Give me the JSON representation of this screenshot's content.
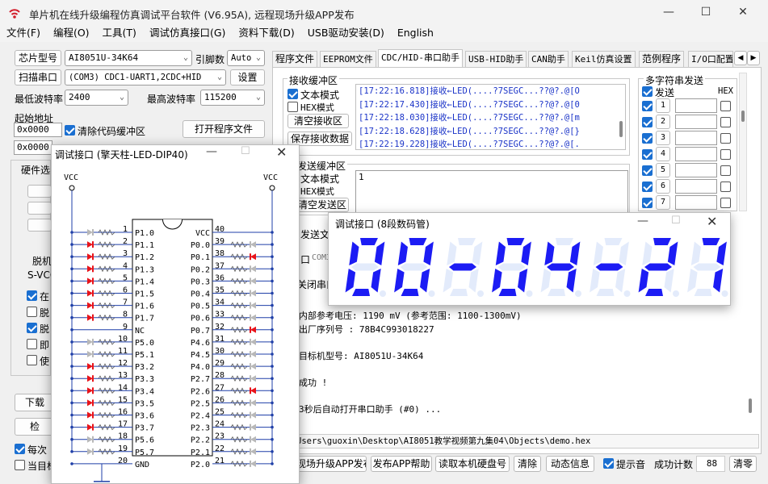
{
  "app": {
    "title": "单片机在线升级编程仿真调试平台软件 (V6.95A), 远程现场升级APP发布"
  },
  "menu": [
    "文件(F)",
    "编程(O)",
    "工具(T)",
    "调试仿真接口(G)",
    "资料下载(D)",
    "USB驱动安装(D)",
    "English"
  ],
  "left": {
    "chip_btn": "芯片型号",
    "chip": "AI8051U-34K64",
    "pins_label": "引脚数",
    "pins": "Auto",
    "scan_btn": "扫描串口",
    "port": "(COM3) CDC1-UART1,2CDC+HID",
    "settings_btn": "设置",
    "min_baud_label": "最低波特率",
    "min_baud": "2400",
    "max_baud_label": "最高波特率",
    "max_baud": "115200",
    "start_addr_label": "起始地址",
    "start_addr_1": "0x0000",
    "start_addr_2": "0x0000",
    "clear_cache_label": "清除代码缓冲区",
    "open_prog_btn": "打开程序文件",
    "hw_label": "硬件选",
    "partial": [
      "脱机",
      "S-VCC",
      "在",
      "脱",
      "脱",
      "即",
      "使"
    ],
    "download_btn": "下载",
    "check_btn": "检",
    "every_label": "每次",
    "current_label": "当目标"
  },
  "tabs": [
    "程序文件",
    "EEPROM文件",
    "CDC/HID-串口助手",
    "USB-HID助手",
    "CAN助手",
    "Keil仿真设置",
    "范例程序",
    "I/O口配置"
  ],
  "recv": {
    "title": "接收缓冲区",
    "text_mode": "文本模式",
    "hex_mode": "HEX模式",
    "clear_btn": "清空接收区",
    "save_btn": "保存接收数据",
    "lines": [
      "[17:22:16.818]接收←LED(....?7SEGC...??@?.@[O",
      "[17:22:17.430]接收←LED(....?7SEGC...??@?.@[0",
      "[17:22:18.030]接收←LED(....?7SEGC...??@?.@[m",
      "[17:22:18.628]接收←LED(....?7SEGC...??@?.@[}",
      "[17:22:19.228]接收←LED(....?7SEGC...??@?.@[."
    ]
  },
  "send": {
    "title": "发送缓冲区",
    "text_mode": "文本模式",
    "hex_mode": "HEX模式",
    "clear_btn": "清空发送区",
    "value": "1",
    "send_file": "发送文件",
    "com_partial": "口",
    "com3": "COM3",
    "close_port": "关闭串口"
  },
  "multi": {
    "title": "多字符串发送",
    "send_col": "发送",
    "hex_col": "HEX",
    "rows": [
      "1",
      "2",
      "3",
      "4",
      "5",
      "6",
      "7"
    ]
  },
  "log": {
    "lines": [
      "内部参考电压: 1190 mV (参考范围: 1100-1300mV)",
      "出厂序列号 : 78B4C993018227",
      "",
      "目标机型号: AI8051U-34K64",
      "",
      "成功 !",
      "",
      "3秒后自动打开串口助手 (#0) ..."
    ]
  },
  "path": "Users\\guoxin\\Desktop\\AI8051教学视频第九集04\\Objects\\demo.hex",
  "bottom": {
    "publish_btn": "现场升级APP发布",
    "help_btn": "发布APP帮助",
    "disk_btn": "读取本机硬盘号",
    "clear_btn": "清除",
    "dyn_btn": "动态信息",
    "beep_label": "提示音",
    "count_label": "成功计数",
    "count": "88",
    "reset_btn": "清零"
  },
  "led_win": {
    "title": "调试接口 (8段数码管)",
    "digits": [
      "0",
      "0",
      "-",
      "0",
      "4",
      "-",
      "2",
      "7"
    ]
  },
  "dip_win": {
    "title": "调试接口 (擎天柱-LED-DIP40)",
    "vcc": "VCC",
    "left_pins": [
      {
        "n": "1",
        "name": "P1.0",
        "led": "off"
      },
      {
        "n": "2",
        "name": "P1.1",
        "led": "on"
      },
      {
        "n": "3",
        "name": "P1.2",
        "led": "on"
      },
      {
        "n": "4",
        "name": "P1.3",
        "led": "on"
      },
      {
        "n": "5",
        "name": "P1.4",
        "led": "on"
      },
      {
        "n": "6",
        "name": "P1.5",
        "led": "on"
      },
      {
        "n": "7",
        "name": "P1.6",
        "led": "on"
      },
      {
        "n": "8",
        "name": "P1.7",
        "led": "on"
      },
      {
        "n": "9",
        "name": "NC",
        "led": "none"
      },
      {
        "n": "10",
        "name": "P5.0",
        "led": "off"
      },
      {
        "n": "11",
        "name": "P5.1",
        "led": "off"
      },
      {
        "n": "12",
        "name": "P3.2",
        "led": "on"
      },
      {
        "n": "13",
        "name": "P3.3",
        "led": "on"
      },
      {
        "n": "14",
        "name": "P3.4",
        "led": "on"
      },
      {
        "n": "15",
        "name": "P3.5",
        "led": "on"
      },
      {
        "n": "16",
        "name": "P3.6",
        "led": "on"
      },
      {
        "n": "17",
        "name": "P3.7",
        "led": "on"
      },
      {
        "n": "18",
        "name": "P5.6",
        "led": "off"
      },
      {
        "n": "19",
        "name": "P5.7",
        "led": "off"
      },
      {
        "n": "20",
        "name": "GND",
        "led": "none"
      }
    ],
    "right_pins": [
      {
        "n": "40",
        "name": "VCC",
        "led": "none"
      },
      {
        "n": "39",
        "name": "P0.0",
        "led": "off"
      },
      {
        "n": "38",
        "name": "P0.1",
        "led": "on"
      },
      {
        "n": "37",
        "name": "P0.2",
        "led": "off"
      },
      {
        "n": "36",
        "name": "P0.3",
        "led": "off"
      },
      {
        "n": "35",
        "name": "P0.4",
        "led": "off"
      },
      {
        "n": "34",
        "name": "P0.5",
        "led": "off"
      },
      {
        "n": "33",
        "name": "P0.6",
        "led": "off"
      },
      {
        "n": "32",
        "name": "P0.7",
        "led": "on"
      },
      {
        "n": "31",
        "name": "P4.6",
        "led": "off"
      },
      {
        "n": "30",
        "name": "P4.5",
        "led": "off"
      },
      {
        "n": "29",
        "name": "P4.0",
        "led": "off"
      },
      {
        "n": "28",
        "name": "P2.7",
        "led": "off"
      },
      {
        "n": "27",
        "name": "P2.6",
        "led": "on"
      },
      {
        "n": "26",
        "name": "P2.5",
        "led": "off"
      },
      {
        "n": "25",
        "name": "P2.4",
        "led": "off"
      },
      {
        "n": "24",
        "name": "P2.3",
        "led": "off"
      },
      {
        "n": "23",
        "name": "P2.2",
        "led": "off"
      },
      {
        "n": "22",
        "name": "P2.1",
        "led": "off"
      },
      {
        "n": "21",
        "name": "P2.0",
        "led": "off"
      }
    ]
  },
  "colors": {
    "led_on": "#e8131a",
    "led_off": "#b8b8b8",
    "seg_on": "#1c1cf4",
    "seg_off": "#e3ebfb",
    "wire": "#1f3fa8",
    "text_blue": "#1b34c8"
  }
}
